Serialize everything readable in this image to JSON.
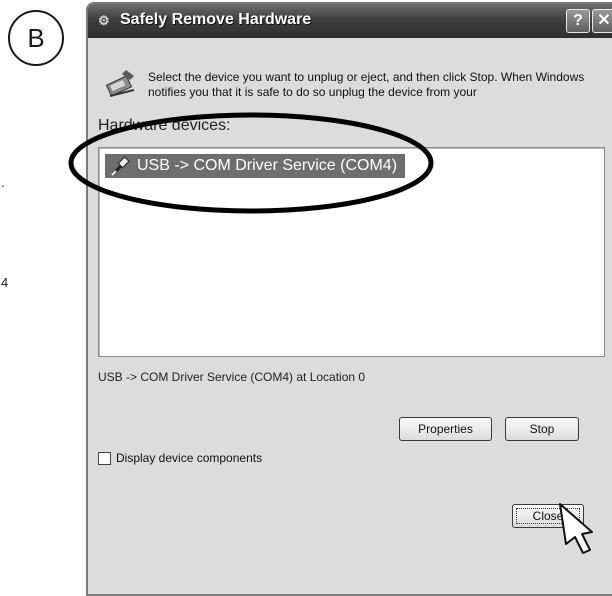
{
  "step_label": "B",
  "margin_marks": [
    ".",
    "4"
  ],
  "window": {
    "title": "Safely Remove Hardware",
    "help_glyph": "?",
    "close_glyph": "✕",
    "instructions": "Select the device you want to unplug or eject, and then click Stop. When Windows notifies you that it is safe to do so unplug the device from your",
    "hardware_label": "Hardware devices:",
    "devices": [
      {
        "label": "USB -> COM Driver Service (COM4)",
        "selected": true
      }
    ],
    "status_text": "USB -> COM Driver Service (COM4) at Location 0",
    "buttons": {
      "properties": "Properties",
      "stop": "Stop",
      "close": "Close"
    },
    "checkbox": {
      "label": "Display device components",
      "checked": false
    }
  },
  "icons": {
    "title": "hardware-tray-icon",
    "header": "safely-remove-hardware-icon",
    "device": "usb-plug-icon",
    "cursor": "hand-pointer-cursor-icon"
  }
}
